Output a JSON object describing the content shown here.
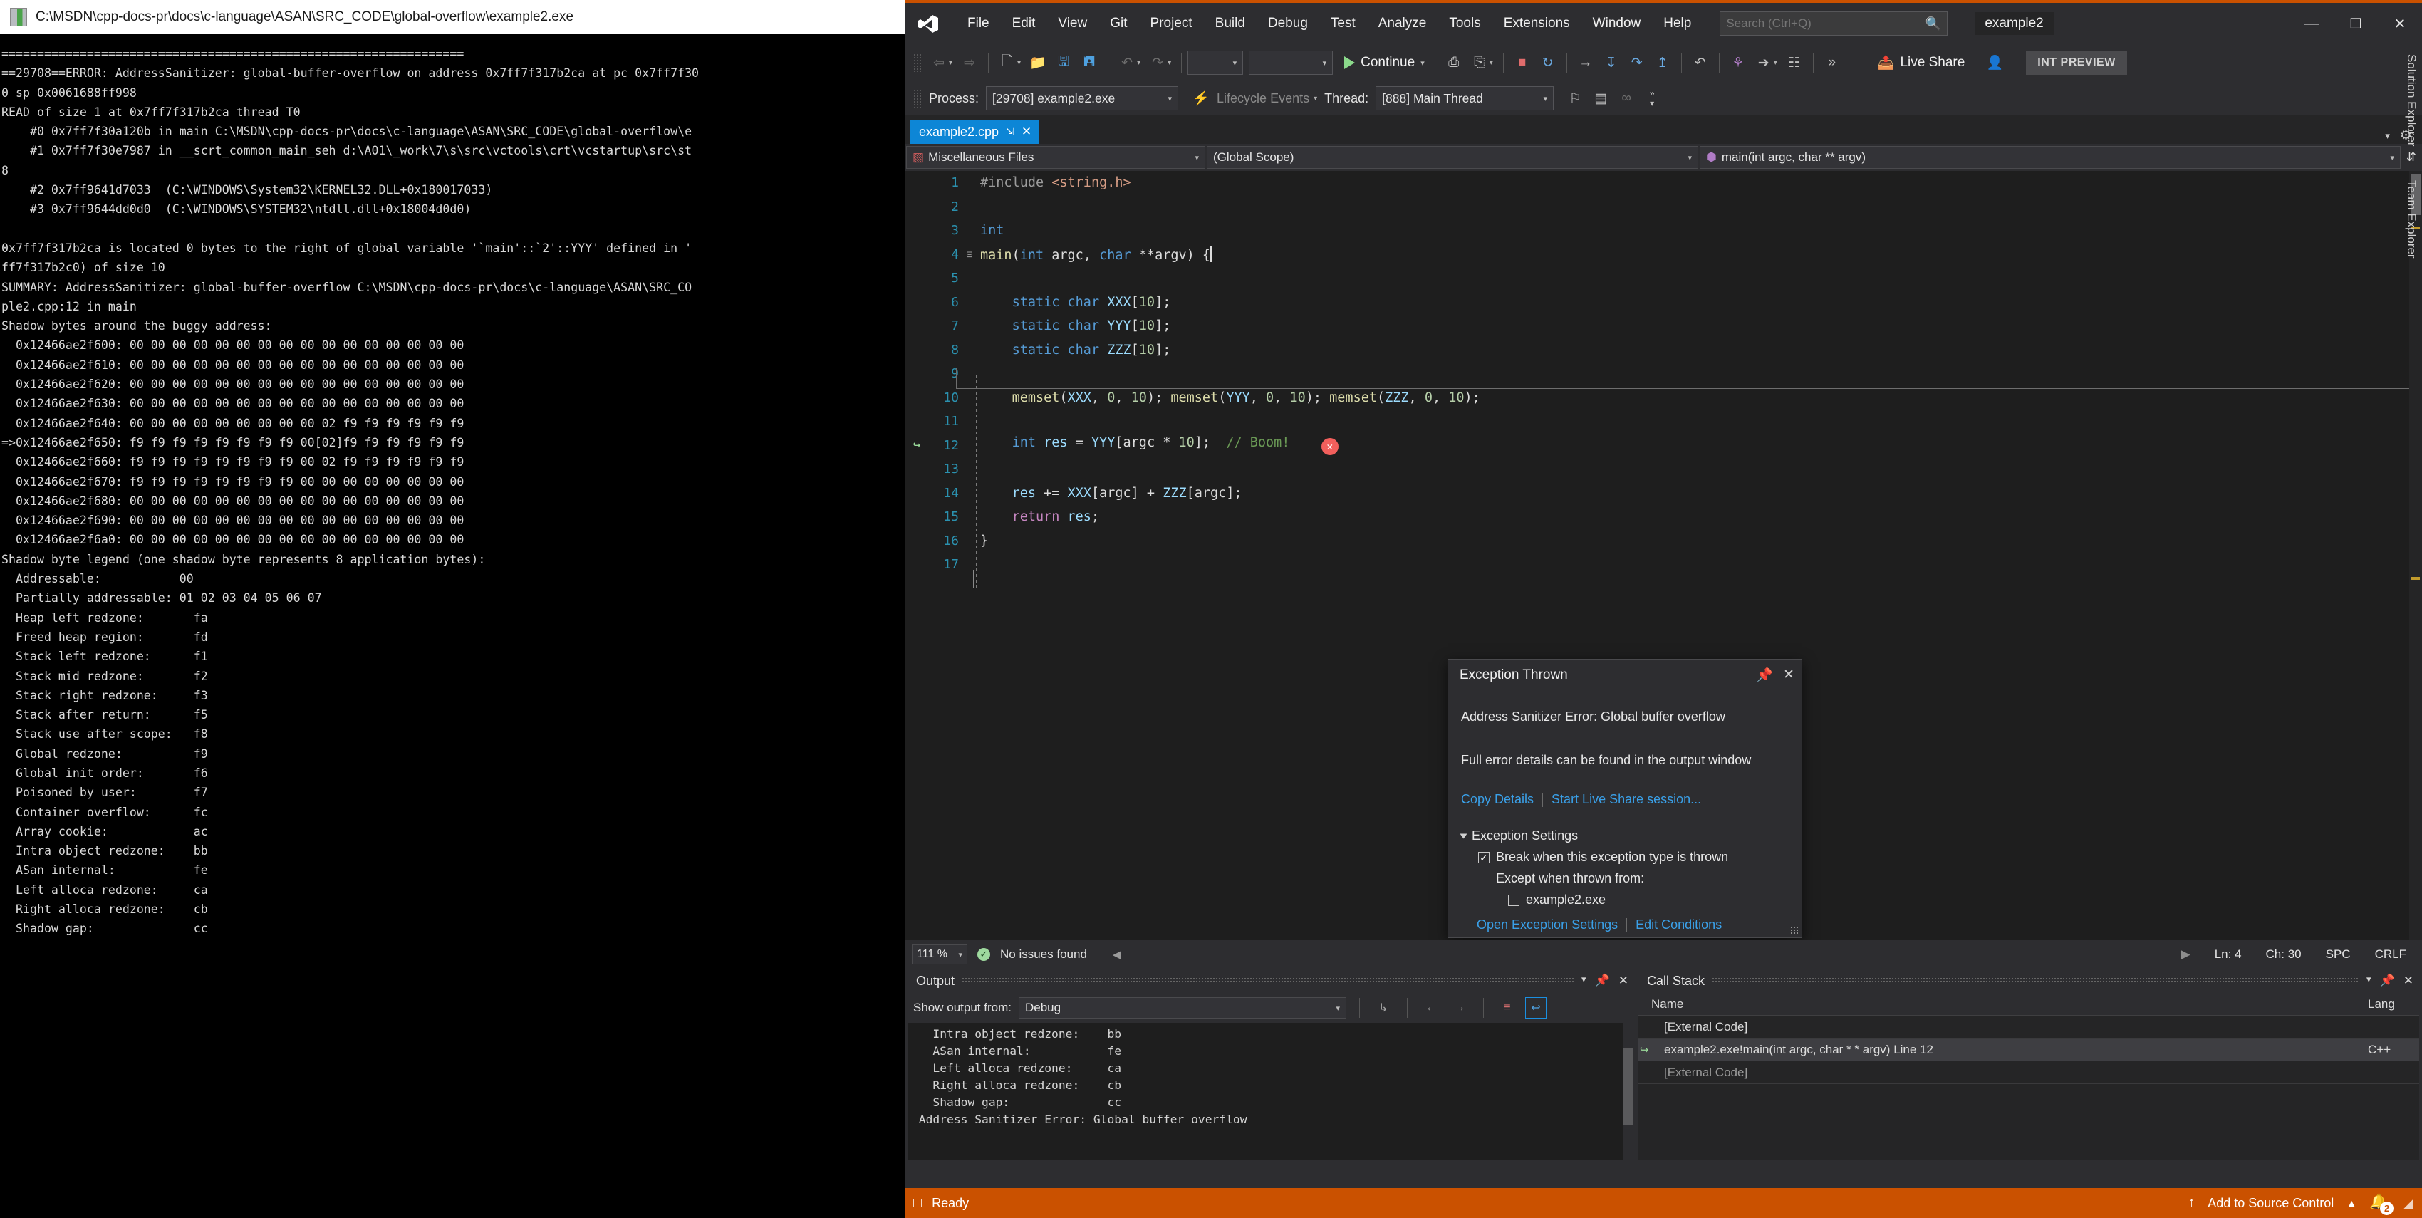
{
  "console": {
    "title": "C:\\MSDN\\cpp-docs-pr\\docs\\c-language\\ASAN\\SRC_CODE\\global-overflow\\example2.exe",
    "lines": [
      "=================================================================",
      "==29708==ERROR: AddressSanitizer: global-buffer-overflow on address 0x7ff7f317b2ca at pc 0x7ff7f30",
      "0 sp 0x0061688ff998",
      "READ of size 1 at 0x7ff7f317b2ca thread T0",
      "    #0 0x7ff7f30a120b in main C:\\MSDN\\cpp-docs-pr\\docs\\c-language\\ASAN\\SRC_CODE\\global-overflow\\e",
      "    #1 0x7ff7f30e7987 in __scrt_common_main_seh d:\\A01\\_work\\7\\s\\src\\vctools\\crt\\vcstartup\\src\\st",
      "8",
      "    #2 0x7ff9641d7033  (C:\\WINDOWS\\System32\\KERNEL32.DLL+0x180017033)",
      "    #3 0x7ff9644dd0d0  (C:\\WINDOWS\\SYSTEM32\\ntdll.dll+0x18004d0d0)",
      "",
      "0x7ff7f317b2ca is located 0 bytes to the right of global variable '`main'::`2'::YYY' defined in '",
      "ff7f317b2c0) of size 10",
      "SUMMARY: AddressSanitizer: global-buffer-overflow C:\\MSDN\\cpp-docs-pr\\docs\\c-language\\ASAN\\SRC_CO",
      "ple2.cpp:12 in main",
      "Shadow bytes around the buggy address:",
      "  0x12466ae2f600: 00 00 00 00 00 00 00 00 00 00 00 00 00 00 00 00",
      "  0x12466ae2f610: 00 00 00 00 00 00 00 00 00 00 00 00 00 00 00 00",
      "  0x12466ae2f620: 00 00 00 00 00 00 00 00 00 00 00 00 00 00 00 00",
      "  0x12466ae2f630: 00 00 00 00 00 00 00 00 00 00 00 00 00 00 00 00",
      "  0x12466ae2f640: 00 00 00 00 00 00 00 00 00 02 f9 f9 f9 f9 f9 f9",
      "=>0x12466ae2f650: f9 f9 f9 f9 f9 f9 f9 f9 00[02]f9 f9 f9 f9 f9 f9",
      "  0x12466ae2f660: f9 f9 f9 f9 f9 f9 f9 f9 00 02 f9 f9 f9 f9 f9 f9",
      "  0x12466ae2f670: f9 f9 f9 f9 f9 f9 f9 f9 00 00 00 00 00 00 00 00",
      "  0x12466ae2f680: 00 00 00 00 00 00 00 00 00 00 00 00 00 00 00 00",
      "  0x12466ae2f690: 00 00 00 00 00 00 00 00 00 00 00 00 00 00 00 00",
      "  0x12466ae2f6a0: 00 00 00 00 00 00 00 00 00 00 00 00 00 00 00 00",
      "Shadow byte legend (one shadow byte represents 8 application bytes):",
      "  Addressable:           00",
      "  Partially addressable: 01 02 03 04 05 06 07",
      "  Heap left redzone:       fa",
      "  Freed heap region:       fd",
      "  Stack left redzone:      f1",
      "  Stack mid redzone:       f2",
      "  Stack right redzone:     f3",
      "  Stack after return:      f5",
      "  Stack use after scope:   f8",
      "  Global redzone:          f9",
      "  Global init order:       f6",
      "  Poisoned by user:        f7",
      "  Container overflow:      fc",
      "  Array cookie:            ac",
      "  Intra object redzone:    bb",
      "  ASan internal:           fe",
      "  Left alloca redzone:     ca",
      "  Right alloca redzone:    cb",
      "  Shadow gap:              cc"
    ]
  },
  "vs": {
    "menu": [
      "File",
      "Edit",
      "View",
      "Git",
      "Project",
      "Build",
      "Debug",
      "Test",
      "Analyze",
      "Tools",
      "Extensions",
      "Window",
      "Help"
    ],
    "search_placeholder": "Search (Ctrl+Q)",
    "solution_name": "example2",
    "window_controls": {
      "minimize": "—",
      "maximize": "☐",
      "close": "✕"
    },
    "toolbar": {
      "continue_label": "Continue",
      "config_value": "",
      "platform_value": "",
      "live_share_label": "Live Share",
      "preview_badge": "INT PREVIEW"
    },
    "debug_bar": {
      "process_label": "Process:",
      "process_value": "[29708] example2.exe",
      "lifecycle_label": "Lifecycle Events",
      "thread_label": "Thread:",
      "thread_value": "[888] Main Thread"
    },
    "tab": {
      "name": "example2.cpp",
      "pin": "⇲",
      "close": "✕"
    },
    "navbar": {
      "project": "Miscellaneous Files",
      "scope": "(Global Scope)",
      "member": "main(int argc, char ** argv)"
    },
    "editor": {
      "lines": [
        {
          "n": "1",
          "html": "<span class=\"pp\">#include</span> <span class=\"str\">&lt;string.h&gt;</span>"
        },
        {
          "n": "2",
          "html": ""
        },
        {
          "n": "3",
          "html": "<span class=\"k\">int</span>"
        },
        {
          "n": "4",
          "html": "<span class=\"fn\">main</span>(<span class=\"k\">int</span> argc, <span class=\"k\">char</span> **argv) {<span class=\"caret-bar\"></span>"
        },
        {
          "n": "5",
          "html": ""
        },
        {
          "n": "6",
          "html": "    <span class=\"k\">static</span> <span class=\"k\">char</span> <span class=\"idb\">XXX</span>[<span class=\"num\">10</span>];"
        },
        {
          "n": "7",
          "html": "    <span class=\"k\">static</span> <span class=\"k\">char</span> <span class=\"idb\">YYY</span>[<span class=\"num\">10</span>];"
        },
        {
          "n": "8",
          "html": "    <span class=\"k\">static</span> <span class=\"k\">char</span> <span class=\"idb\">ZZZ</span>[<span class=\"num\">10</span>];"
        },
        {
          "n": "9",
          "html": ""
        },
        {
          "n": "10",
          "html": "    <span class=\"fn\">memset</span>(<span class=\"idb\">XXX</span>, <span class=\"num\">0</span>, <span class=\"num\">10</span>); <span class=\"fn\">memset</span>(<span class=\"idb\">YYY</span>, <span class=\"num\">0</span>, <span class=\"num\">10</span>); <span class=\"fn\">memset</span>(<span class=\"idb\">ZZZ</span>, <span class=\"num\">0</span>, <span class=\"num\">10</span>);"
        },
        {
          "n": "11",
          "html": ""
        },
        {
          "n": "12",
          "html": "    <span class=\"k\">int</span> <span class=\"idb\">res</span> = <span class=\"idb\">YYY</span>[argc * <span class=\"num\">10</span>];  <span class=\"cm\">// Boom!</span>  <span class=\"errdot\">✕</span>"
        },
        {
          "n": "13",
          "html": ""
        },
        {
          "n": "14",
          "html": "    <span class=\"idb\">res</span> += <span class=\"idb\">XXX</span>[argc] + <span class=\"idb\">ZZZ</span>[argc];"
        },
        {
          "n": "15",
          "html": "    <span class=\"kp\">return</span> <span class=\"idb\">res</span>;"
        },
        {
          "n": "16",
          "html": "}"
        },
        {
          "n": "17",
          "html": ""
        }
      ]
    },
    "exception_popup": {
      "title": "Exception Thrown",
      "message": "Address Sanitizer Error: Global buffer overflow",
      "details": "Full error details can be found in the output window",
      "copy_details": "Copy Details",
      "live_share": "Start Live Share session...",
      "settings_header": "Exception Settings",
      "break_label": "Break when this exception type is thrown",
      "break_checked": "✓",
      "except_label": "Except when thrown from:",
      "module_label": "example2.exe",
      "module_checked": "",
      "open_settings": "Open Exception Settings",
      "edit_conditions": "Edit Conditions"
    },
    "editor_status": {
      "zoom": "111 %",
      "issues": "No issues found",
      "line": "Ln: 4",
      "col": "Ch: 30",
      "spaces": "SPC",
      "eol": "CRLF"
    },
    "output_panel": {
      "title": "Output",
      "show_from_label": "Show output from:",
      "show_from_value": "Debug",
      "lines": [
        "   Intra object redzone:    bb",
        "   ASan internal:           fe",
        "   Left alloca redzone:     ca",
        "   Right alloca redzone:    cb",
        "   Shadow gap:              cc",
        " Address Sanitizer Error: Global buffer overflow"
      ]
    },
    "callstack_panel": {
      "title": "Call Stack",
      "columns": [
        "Name",
        "Lang"
      ],
      "rows": [
        {
          "name": "[External Code]",
          "lang": "",
          "current": false,
          "external": false
        },
        {
          "name": "example2.exe!main(int argc, char * * argv) Line 12",
          "lang": "C++",
          "current": true,
          "external": false
        },
        {
          "name": "[External Code]",
          "lang": "",
          "current": false,
          "external": true
        }
      ]
    },
    "status_bar": {
      "ready": "Ready",
      "source_control": "Add to Source Control",
      "notifications": "2"
    },
    "vertical_tabs": [
      "Solution Explorer",
      "Team Explorer"
    ]
  }
}
